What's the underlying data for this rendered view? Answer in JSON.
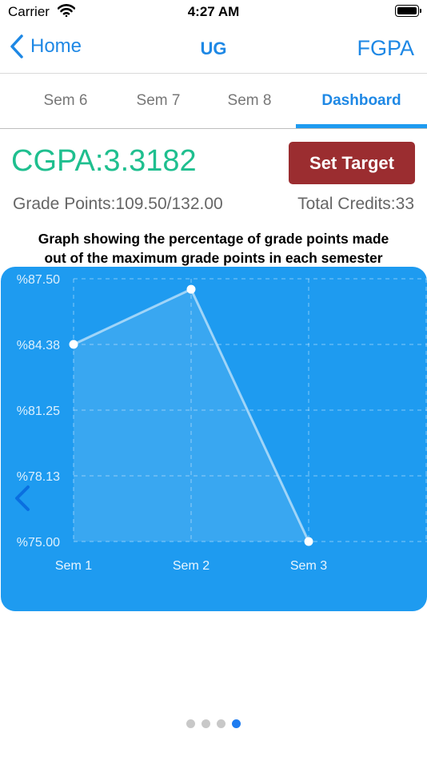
{
  "status_bar": {
    "carrier": "Carrier",
    "time": "4:27 AM"
  },
  "nav": {
    "back_label": "Home",
    "title": "UG",
    "right_label": "FGPA"
  },
  "tabs": [
    {
      "label": "Sem 6",
      "active": false
    },
    {
      "label": "Sem 7",
      "active": false
    },
    {
      "label": "Sem 8",
      "active": false
    },
    {
      "label": "Dashboard",
      "active": true
    }
  ],
  "summary": {
    "cgpa": "CGPA:3.3182",
    "set_target_label": "Set Target",
    "grade_points": "Grade Points:109.50/132.00",
    "total_credits": "Total Credits:33"
  },
  "chart_title_line1": "Graph showing the percentage of grade points made",
  "chart_title_line2": "out of the maximum grade points in each semester",
  "colors": {
    "accent": "#1e88e5",
    "cgpa": "#1fbf8f",
    "button": "#9b2d30",
    "chart_bg": "#1e9bf0"
  },
  "chart_data": {
    "type": "line",
    "categories": [
      "Sem 1",
      "Sem 2",
      "Sem 3"
    ],
    "series": [
      {
        "values": [
          84.38,
          87.0,
          75.0
        ]
      }
    ],
    "yticks": [
      "%87.50",
      "%84.38",
      "%81.25",
      "%78.13",
      "%75.00"
    ],
    "ylim": [
      75.0,
      87.5
    ],
    "grid": true,
    "area_fill": true
  },
  "pager": {
    "count": 4,
    "active": 3
  }
}
